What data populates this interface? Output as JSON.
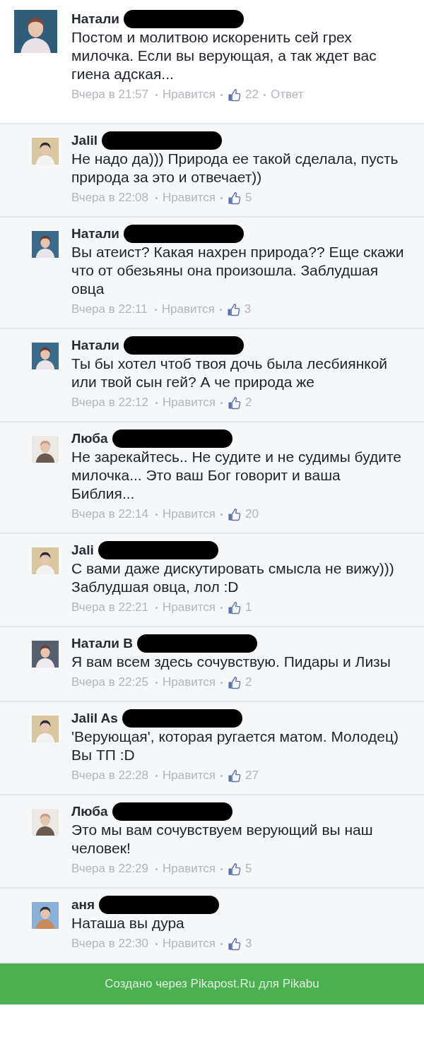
{
  "comments": [
    {
      "kind": "comment",
      "author": "Натали",
      "redacted": true,
      "text": "Постом и молитвою искоренить сей грех милочка. Если вы верующая, а так ждет вас гиена адская...",
      "time": "Вчера в 21:57",
      "like_label": "Нравится",
      "likes": "22",
      "reply_label": "Ответ"
    },
    {
      "kind": "reply",
      "author": "Jalil",
      "redacted": true,
      "text": "Не надо да))) Природа ее такой сделала, пусть природа за это и отвечает))",
      "time": "Вчера в 22:08",
      "like_label": "Нравится",
      "likes": "5"
    },
    {
      "kind": "reply",
      "author": "Натали",
      "redacted": true,
      "text": "Вы атеист? Какая нахрен природа?? Еще скажи что от обезьяны она произошла. Заблудшая овца",
      "time": "Вчера в 22:11",
      "like_label": "Нравится",
      "likes": "3"
    },
    {
      "kind": "reply",
      "author": "Натали",
      "redacted": true,
      "text": "Ты бы хотел чтоб твоя дочь была лесбиянкой или твой сын гей? А че природа же",
      "time": "Вчера в 22:12",
      "like_label": "Нравится",
      "likes": "2"
    },
    {
      "kind": "reply",
      "author": "Люба",
      "redacted": true,
      "text": "Не зарекайтесь.. Не судите и не судимы будите милочка... Это ваш Бог говорит и ваша Библия...",
      "time": "Вчера в 22:14",
      "like_label": "Нравится",
      "likes": "20"
    },
    {
      "kind": "reply",
      "author": "Jali",
      "redacted": true,
      "text": "С вами даже дискутировать смысла не вижу))) Заблудшая овца, лол :D",
      "time": "Вчера в 22:21",
      "like_label": "Нравится",
      "likes": "1"
    },
    {
      "kind": "reply",
      "author": "Натали В",
      "redacted": true,
      "text": "Я вам всем здесь сочувствую. Пидары и Лизы",
      "time": "Вчера в 22:25",
      "like_label": "Нравится",
      "likes": "2"
    },
    {
      "kind": "reply",
      "author": "Jalil As",
      "redacted": true,
      "text": "'Верующая', которая ругается матом. Молодец) Вы ТП :D",
      "time": "Вчера в 22:28",
      "like_label": "Нравится",
      "likes": "27"
    },
    {
      "kind": "reply",
      "author": "Люба",
      "redacted": true,
      "text": "Это мы вам сочувствуем верующий вы наш человек!",
      "time": "Вчера в 22:29",
      "like_label": "Нравится",
      "likes": "5"
    },
    {
      "kind": "reply",
      "author": "аня",
      "redacted": true,
      "text": "Наташа вы дура",
      "time": "Вчера в 22:30",
      "like_label": "Нравится",
      "likes": "3"
    }
  ],
  "footer": {
    "text": "Создано через Pikapost.Ru для Pikabu"
  }
}
